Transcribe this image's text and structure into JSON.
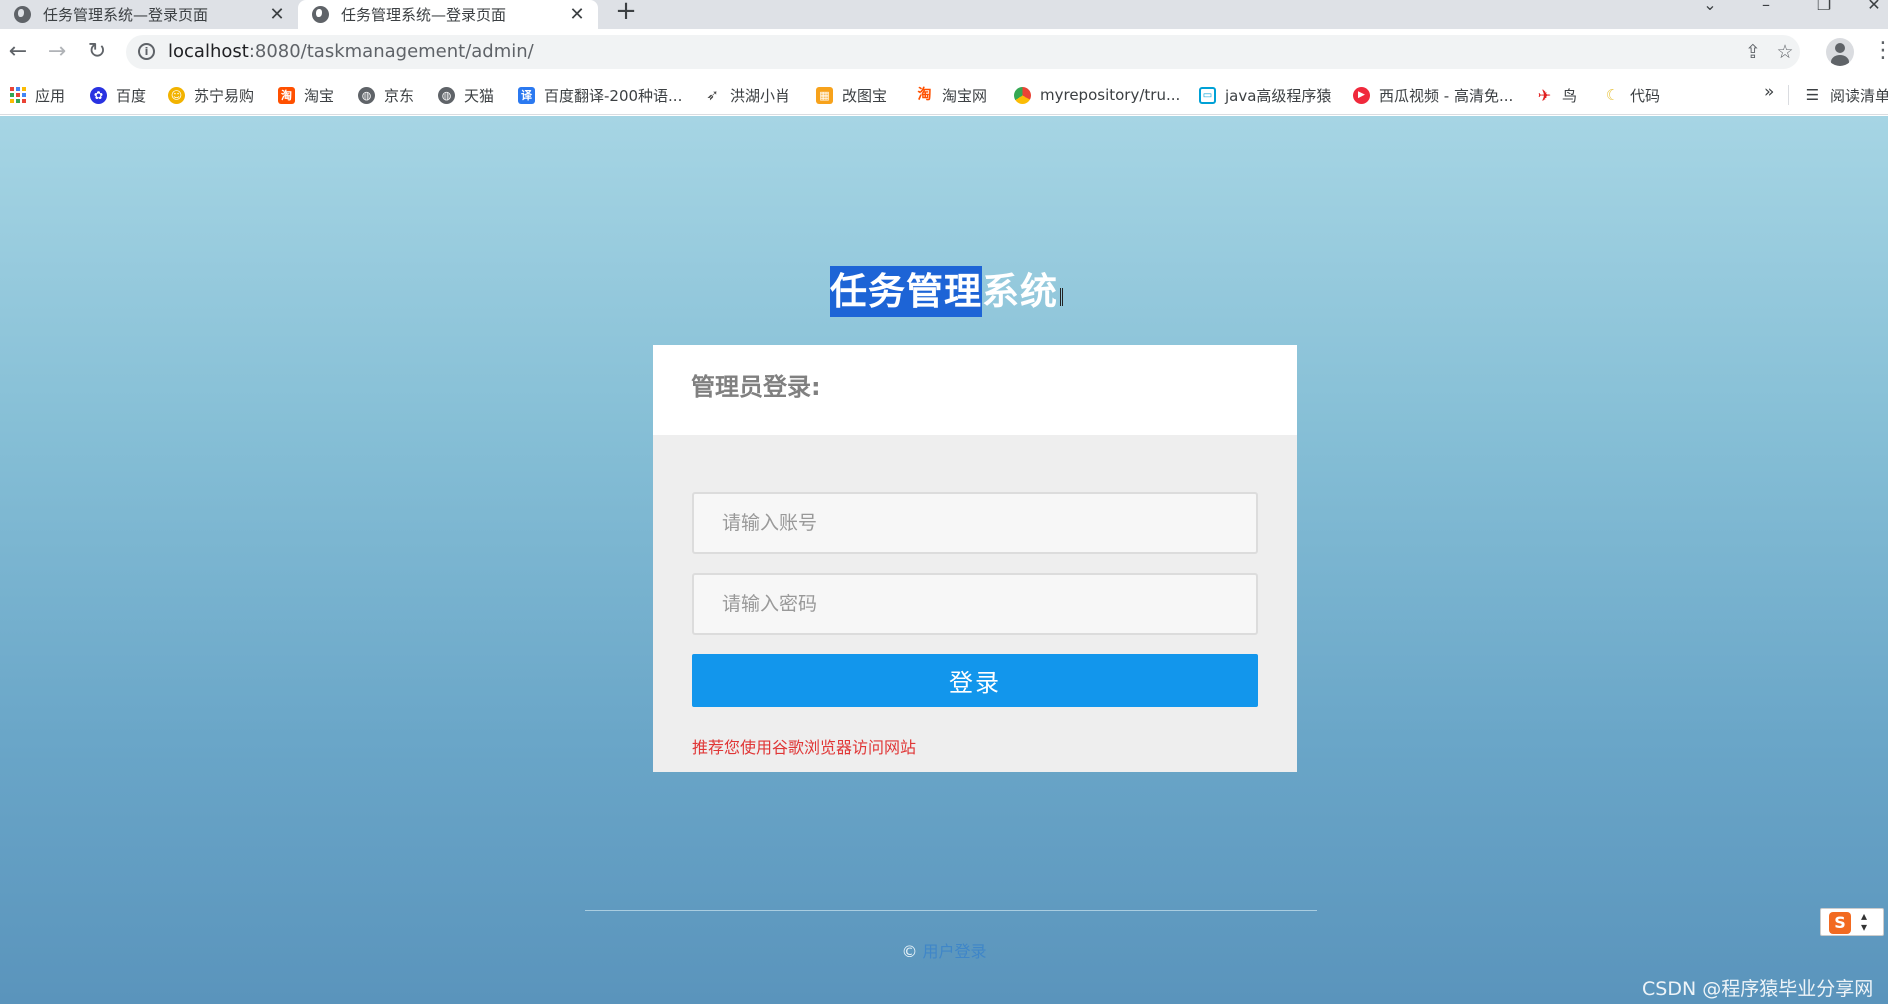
{
  "browser": {
    "tabs": [
      {
        "title": "任务管理系统—登录页面",
        "active": false
      },
      {
        "title": "任务管理系统—登录页面",
        "active": true
      }
    ],
    "new_tab_label": "+",
    "address": {
      "host": "localhost",
      "rest": ":8080/taskmanagement/admin/"
    },
    "bookmarks": [
      {
        "label": "应用",
        "icon": "apps-grid-icon"
      },
      {
        "label": "百度",
        "icon": "baidu-paw-icon",
        "color": "#2932e1"
      },
      {
        "label": "苏宁易购",
        "icon": "suning-icon",
        "color": "#f2b300"
      },
      {
        "label": "淘宝",
        "icon": "taobao-icon",
        "color": "#ff5000"
      },
      {
        "label": "京东",
        "icon": "globe-icon",
        "color": "#5f6368"
      },
      {
        "label": "天猫",
        "icon": "globe-icon",
        "color": "#5f6368"
      },
      {
        "label": "百度翻译-200种语...",
        "icon": "translate-icon",
        "color": "#2b79f0"
      },
      {
        "label": "洪湖小肖",
        "icon": "bird-icon",
        "color": "#4a4a4a"
      },
      {
        "label": "改图宝",
        "icon": "gaitubao-icon",
        "color": "#f7a21b"
      },
      {
        "label": "淘宝网",
        "icon": "taobao-icon",
        "color": "#ff5000"
      },
      {
        "label": "myrepository/tru...",
        "icon": "chrome-icon",
        "color": "#e94235"
      },
      {
        "label": "java高级程序猿",
        "icon": "bilibili-icon",
        "color": "#00a1d6"
      },
      {
        "label": "西瓜视频 - 高清免...",
        "icon": "xigua-icon",
        "color": "#f0293c"
      },
      {
        "label": "鸟",
        "icon": "bird-red-icon",
        "color": "#e02020"
      },
      {
        "label": "代码",
        "icon": "moon-icon",
        "color": "#f5d76e"
      }
    ],
    "bookmarks_more": "»",
    "reading_list": "阅读清单"
  },
  "page": {
    "title_selected": "任务管理",
    "title_rest": "系统",
    "login": {
      "heading": "管理员登录:",
      "account_placeholder": "请输入账号",
      "password_placeholder": "请输入密码",
      "submit_label": "登录",
      "tip": "推荐您使用谷歌浏览器访问网站"
    },
    "footer": {
      "copyright": "©",
      "link": "用户登录"
    }
  },
  "overlay": {
    "ime_logo": "S",
    "watermark": "CSDN @程序猿毕业分享网"
  }
}
